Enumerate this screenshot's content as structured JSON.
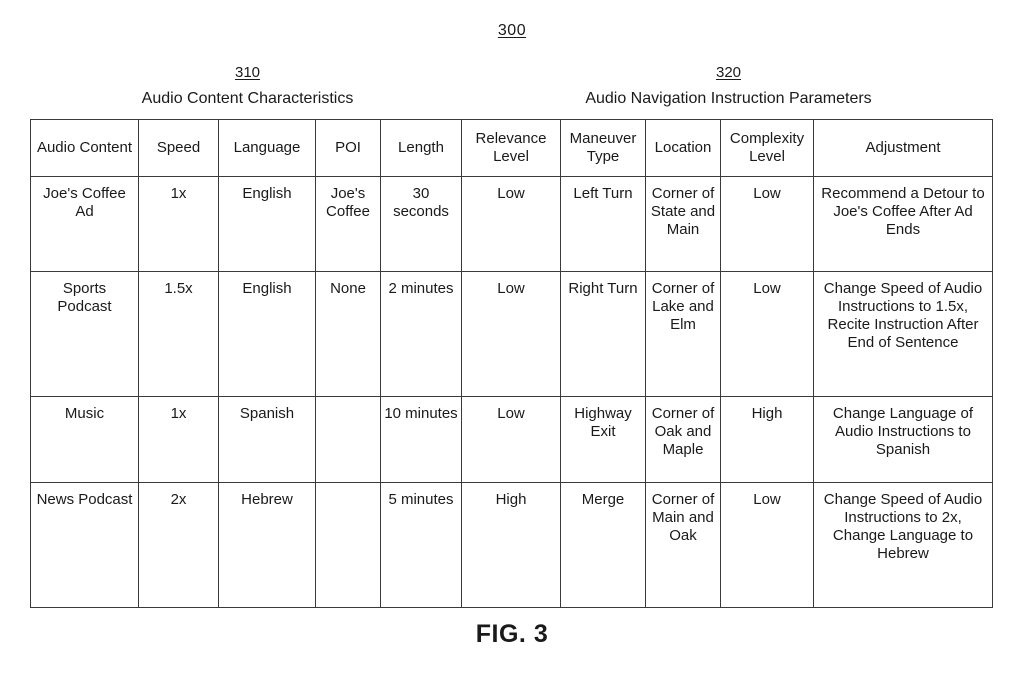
{
  "figure": {
    "top_reference": "300",
    "caption": "FIG. 3"
  },
  "groups": [
    {
      "number": "310",
      "label": "Audio Content Characteristics"
    },
    {
      "number": "320",
      "label": "Audio Navigation Instruction Parameters"
    }
  ],
  "table": {
    "headers": [
      "Audio Content",
      "Speed",
      "Language",
      "POI",
      "Length",
      "Relevance Level",
      "Maneuver Type",
      "Location",
      "Complexity Level",
      "Adjustment"
    ],
    "rows": [
      {
        "audio_content": "Joe's Coffee Ad",
        "speed": "1x",
        "language": "English",
        "poi": "Joe's Coffee",
        "length": "30 seconds",
        "relevance_level": "Low",
        "maneuver_type": "Left Turn",
        "location": "Corner of State and Main",
        "complexity_level": "Low",
        "adjustment": "Recommend a Detour to Joe's Coffee After Ad Ends"
      },
      {
        "audio_content": "Sports Podcast",
        "speed": "1.5x",
        "language": "English",
        "poi": "None",
        "length": "2 minutes",
        "relevance_level": "Low",
        "maneuver_type": "Right Turn",
        "location": "Corner of Lake and Elm",
        "complexity_level": "Low",
        "adjustment": "Change Speed of Audio Instructions to 1.5x, Recite Instruction After End of Sentence"
      },
      {
        "audio_content": "Music",
        "speed": "1x",
        "language": "Spanish",
        "poi": "",
        "length": "10 minutes",
        "relevance_level": "Low",
        "maneuver_type": "Highway Exit",
        "location": "Corner of Oak and Maple",
        "complexity_level": "High",
        "adjustment": "Change Language of Audio Instructions to Spanish"
      },
      {
        "audio_content": "News Podcast",
        "speed": "2x",
        "language": "Hebrew",
        "poi": "",
        "length": "5 minutes",
        "relevance_level": "High",
        "maneuver_type": "Merge",
        "location": "Corner of Main and Oak",
        "complexity_level": "Low",
        "adjustment": "Change Speed of Audio Instructions to 2x, Change Language to Hebrew"
      }
    ]
  },
  "colors": {
    "background": "#ffffff",
    "ink": "#1a1a1a",
    "rule": "#3a3a3a"
  }
}
